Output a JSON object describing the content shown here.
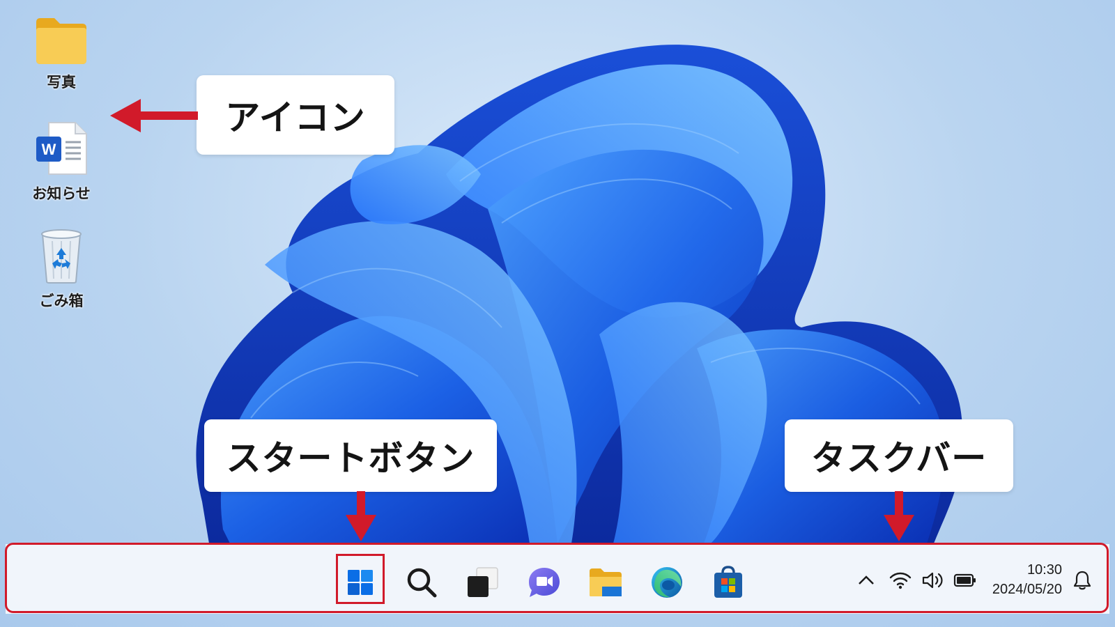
{
  "desktop": {
    "icons": [
      {
        "label": "写真",
        "icon": "folder-icon"
      },
      {
        "label": "お知らせ",
        "icon": "word-document-icon"
      },
      {
        "label": "ごみ箱",
        "icon": "recycle-bin-icon"
      }
    ]
  },
  "callouts": {
    "icon": "アイコン",
    "start": "スタートボタン",
    "taskbar": "タスクバー"
  },
  "taskbar": {
    "apps": [
      {
        "name": "start",
        "icon": "windows-logo-icon"
      },
      {
        "name": "search",
        "icon": "search-icon"
      },
      {
        "name": "task-view",
        "icon": "task-view-icon"
      },
      {
        "name": "chat",
        "icon": "teams-chat-icon"
      },
      {
        "name": "file-explorer",
        "icon": "file-explorer-icon"
      },
      {
        "name": "edge",
        "icon": "edge-browser-icon"
      },
      {
        "name": "store",
        "icon": "microsoft-store-icon"
      }
    ],
    "tray": {
      "icons": [
        "chevron-up-icon",
        "wifi-icon",
        "volume-icon",
        "battery-icon",
        "bell-icon"
      ],
      "time": "10:30",
      "date": "2024/05/20"
    }
  },
  "colors": {
    "accent_red": "#d11a2a",
    "windows_blue": "#0a6ee6",
    "folder_yellow": "#f5c542"
  }
}
